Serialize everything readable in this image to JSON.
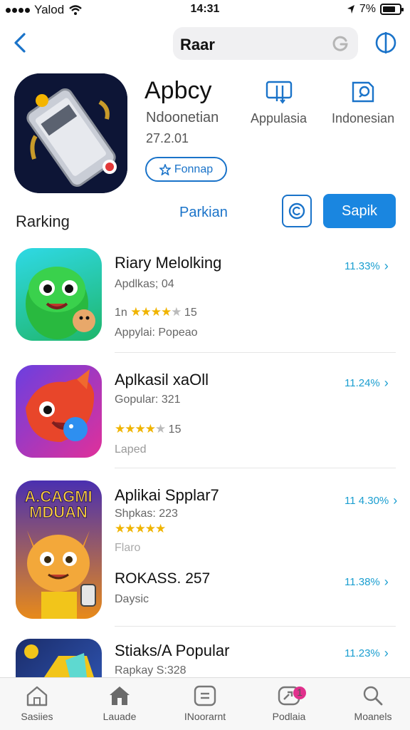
{
  "status": {
    "carrier": "Yalod",
    "time": "14:31",
    "battery": "7%"
  },
  "nav": {
    "search_text": "Raar"
  },
  "app": {
    "title": "Apbcy",
    "subtitle": "Ndoonetian",
    "date": "27.2.01",
    "follow_label": "Fonnap",
    "meta": [
      {
        "icon": "device-icon",
        "label": "Appulasia"
      },
      {
        "icon": "edit-icon",
        "label": "Indonesian"
      }
    ]
  },
  "section": {
    "label": "Rarking",
    "link": "Parkian",
    "primary_button": "Sapik"
  },
  "rows": [
    {
      "name": "Riary Melolking",
      "line1": "Apdlkas; 04",
      "rating_prefix": "1n",
      "rating_count": "15",
      "line3": "Appylai: Popeao",
      "pct": "11.33%"
    },
    {
      "name": "Aplkasil xaOll",
      "line1": "Gopular: 321",
      "rating_count": "15",
      "line3": "Laped",
      "pct": "11.24%"
    },
    {
      "name": "Aplikai Spplar7",
      "line1": "Shpkas: 223",
      "line3": "Flaro",
      "extra": "ROKASS. 257",
      "extra_sub": "Daysic",
      "pct": "11 4.30%",
      "pct2": "11.38%",
      "icon_text_top": "A.CAGMI",
      "icon_text_bottom": "MDUAN"
    },
    {
      "name": "Stiaks/A Popular",
      "line1": "Rapkay S:328",
      "pct": "11.23%"
    }
  ],
  "tabs": [
    {
      "label": "Sasiies",
      "icon": "home-icon"
    },
    {
      "label": "Lauade",
      "icon": "house-icon"
    },
    {
      "label": "INoorarnt",
      "icon": "document-icon"
    },
    {
      "label": "Podlaia",
      "icon": "link-icon",
      "badge": "1"
    },
    {
      "label": "Moanels",
      "icon": "search-icon"
    }
  ]
}
